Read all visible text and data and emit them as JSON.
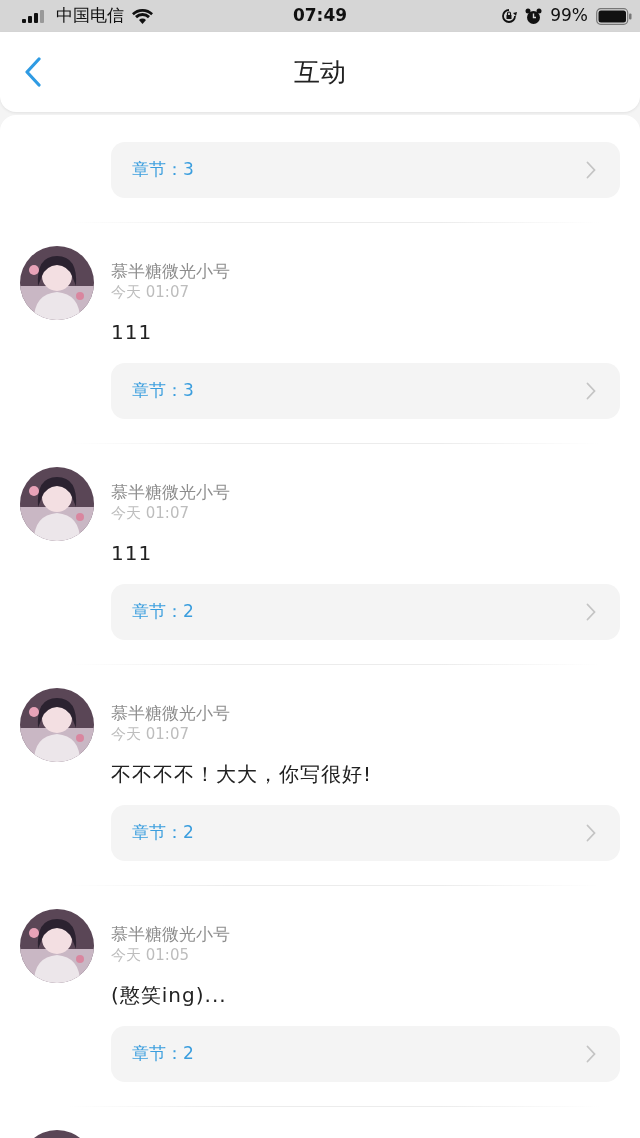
{
  "status_bar": {
    "carrier": "中国电信",
    "time": "07:49",
    "battery": "99%"
  },
  "header": {
    "title": "互动"
  },
  "comments": [
    {
      "kind": "partial",
      "chapter": "章节：3"
    },
    {
      "kind": "full",
      "author": "慕半糖微光小号",
      "time": "今天 01:07",
      "text": "111",
      "chapter": "章节：3"
    },
    {
      "kind": "full",
      "author": "慕半糖微光小号",
      "time": "今天 01:07",
      "text": "111",
      "chapter": "章节：2"
    },
    {
      "kind": "full",
      "author": "慕半糖微光小号",
      "time": "今天 01:07",
      "text": "不不不不！大大，你写很好!",
      "chapter": "章节：2"
    },
    {
      "kind": "full",
      "author": "慕半糖微光小号",
      "time": "今天 01:05",
      "text": "(憨笑ing)...",
      "chapter": "章节：2"
    },
    {
      "kind": "avatar_only"
    }
  ]
}
